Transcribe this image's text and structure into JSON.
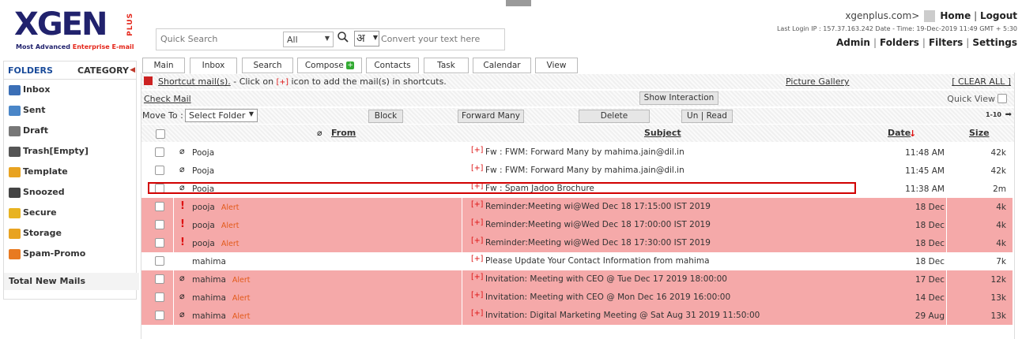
{
  "brand": {
    "logo_text": "XGEN",
    "logo_plus": "PLUS",
    "tagline_a": "Most Advanced ",
    "tagline_b": "Enterprise E-mail"
  },
  "search": {
    "placeholder": "Quick Search",
    "scope": "All",
    "convert_placeholder": "Convert your text here",
    "hindi_char": "अ"
  },
  "header": {
    "user": "xgenplus.com>",
    "home": "Home",
    "logout": "Logout",
    "last_login": "Last Login IP : 157.37.163.242 Date - Time: 19-Dec-2019 11:49 GMT + 5:30",
    "admin": "Admin",
    "folders": "Folders",
    "filters": "Filters",
    "settings": "Settings"
  },
  "sidebar": {
    "folders_label": "FOLDERS",
    "category_label": "CATEGORY",
    "items": [
      {
        "label": "Inbox",
        "icon": "inbox-icon",
        "color": "#3b6fb6"
      },
      {
        "label": "Sent",
        "icon": "sent-icon",
        "color": "#4a86c8"
      },
      {
        "label": "Draft",
        "icon": "draft-icon",
        "color": "#777777"
      },
      {
        "label": "Trash[Empty]",
        "icon": "trash-icon",
        "color": "#555555"
      },
      {
        "label": "Template",
        "icon": "template-icon",
        "color": "#e8a321"
      },
      {
        "label": "Snoozed",
        "icon": "snooze-icon",
        "color": "#444444"
      },
      {
        "label": "Secure",
        "icon": "lock-icon",
        "color": "#e8b321"
      },
      {
        "label": "Storage",
        "icon": "storage-icon",
        "color": "#e8a321"
      },
      {
        "label": "Spam-Promo",
        "icon": "spam-icon",
        "color": "#e87a21"
      }
    ],
    "total_new": "Total New Mails"
  },
  "tabs": [
    "Main",
    "Inbox",
    "Search",
    "Compose",
    "Contacts",
    "Task",
    "Calendar",
    "View"
  ],
  "toolbar": {
    "shortcut_link": "Shortcut mail(s).",
    "shortcut_text_a": " - Click on ",
    "shortcut_plus": "[+]",
    "shortcut_text_b": " icon to add the mail(s) in shortcuts.",
    "picture_gallery": "Picture Gallery",
    "clear_all": "[ CLEAR ALL ]",
    "check_mail": "Check Mail",
    "show_interaction": "Show Interaction",
    "quick_view": "Quick View",
    "move_to": "Move To :",
    "select_folder": "Select Folder",
    "block": "Block",
    "forward_many": "Forward Many",
    "delete": "Delete",
    "un_read": "Un | Read",
    "paging": "1-10"
  },
  "columns": {
    "from": "From",
    "subject": "Subject",
    "date": "Date",
    "size": "Size"
  },
  "emails": [
    {
      "from": "Pooja",
      "alert": "",
      "attach": true,
      "important": false,
      "plus": "[+]",
      "subject": "Fw : FWM: Forward Many by mahima.jain@dil.in",
      "date": "11:48 AM",
      "size": "42k",
      "highlight": false
    },
    {
      "from": "Pooja",
      "alert": "",
      "attach": true,
      "important": false,
      "plus": "[+]",
      "subject": "Fw : FWM: Forward Many by mahima.jain@dil.in",
      "date": "11:45 AM",
      "size": "42k",
      "highlight": false
    },
    {
      "from": "Pooja",
      "alert": "",
      "attach": true,
      "important": false,
      "plus": "[+]",
      "subject": "Fw : Spam Jadoo Brochure",
      "date": "11:38 AM",
      "size": "2m",
      "highlight": false
    },
    {
      "from": "pooja",
      "alert": "Alert",
      "attach": false,
      "important": true,
      "plus": "[+]",
      "subject": "Reminder:Meeting wi@Wed Dec 18 17:15:00 IST 2019",
      "date": "18 Dec",
      "size": "4k",
      "highlight": true
    },
    {
      "from": "pooja",
      "alert": "Alert",
      "attach": false,
      "important": true,
      "plus": "[+]",
      "subject": "Reminder:Meeting wi@Wed Dec 18 17:00:00 IST 2019",
      "date": "18 Dec",
      "size": "4k",
      "highlight": true
    },
    {
      "from": "pooja",
      "alert": "Alert",
      "attach": false,
      "important": true,
      "plus": "[+]",
      "subject": "Reminder:Meeting wi@Wed Dec 18 17:30:00 IST 2019",
      "date": "18 Dec",
      "size": "4k",
      "highlight": true
    },
    {
      "from": "mahima",
      "alert": "",
      "attach": false,
      "important": false,
      "plus": "[+]",
      "subject": "Please Update Your Contact Information from mahima",
      "date": "18 Dec",
      "size": "7k",
      "highlight": false
    },
    {
      "from": "mahima",
      "alert": "Alert",
      "attach": true,
      "important": false,
      "plus": "[+]",
      "subject": "Invitation: Meeting with CEO @ Tue Dec 17 2019 18:00:00",
      "date": "17 Dec",
      "size": "12k",
      "highlight": true
    },
    {
      "from": "mahima",
      "alert": "Alert",
      "attach": true,
      "important": false,
      "plus": "[+]",
      "subject": "Invitation: Meeting with CEO @ Mon Dec 16 2019 16:00:00",
      "date": "14 Dec",
      "size": "13k",
      "highlight": true
    },
    {
      "from": "mahima",
      "alert": "Alert",
      "attach": true,
      "important": false,
      "plus": "[+]",
      "subject": "Invitation: Digital Marketing Meeting @ Sat Aug 31 2019 11:50:00",
      "date": "29 Aug",
      "size": "13k",
      "highlight": true
    }
  ],
  "colors": {
    "brand": "#21226d",
    "accent": "#e4261a",
    "alert_row": "#f5a9a9"
  }
}
